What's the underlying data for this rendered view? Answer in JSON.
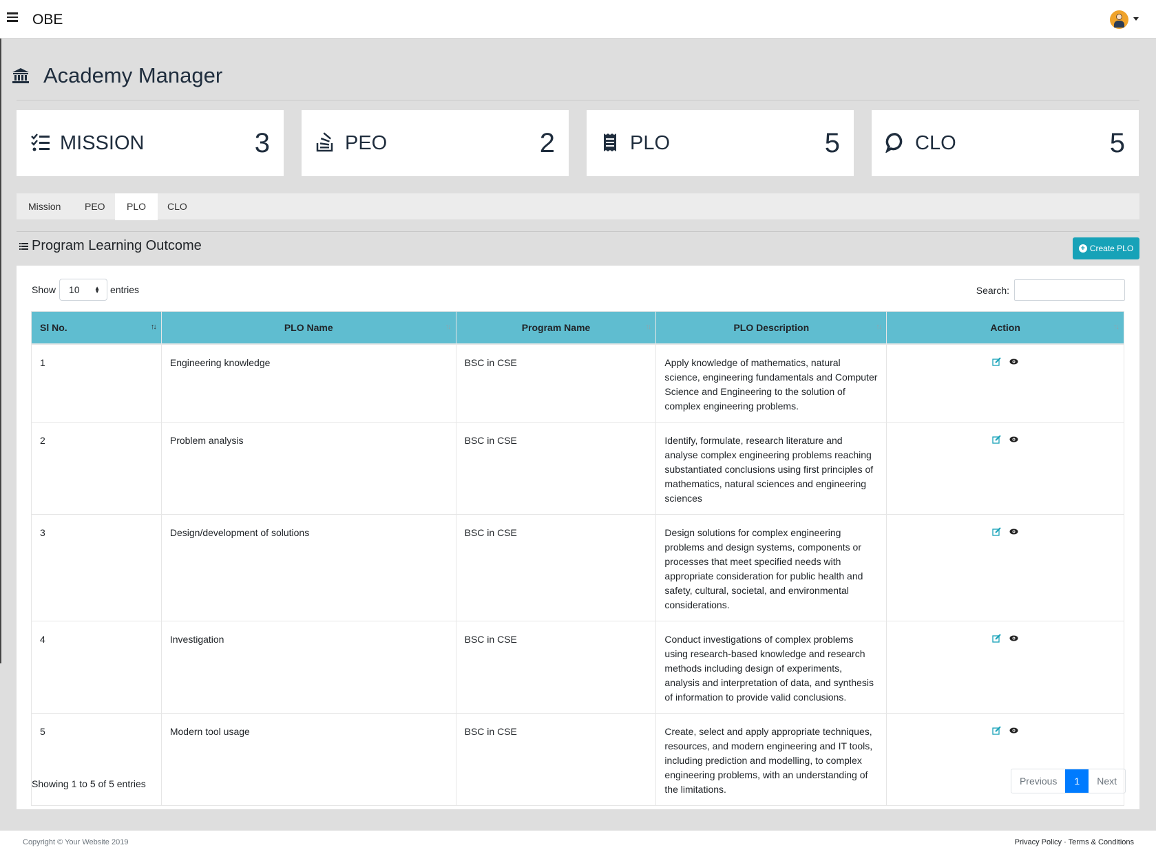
{
  "app": {
    "brand": "OBE"
  },
  "page": {
    "title": "Academy Manager"
  },
  "cards": [
    {
      "label": "MISSION",
      "count": "3",
      "icon": "list-check-icon"
    },
    {
      "label": "PEO",
      "count": "2",
      "icon": "stack-icon"
    },
    {
      "label": "PLO",
      "count": "5",
      "icon": "receipt-icon"
    },
    {
      "label": "CLO",
      "count": "5",
      "icon": "chat-bubble-icon"
    }
  ],
  "tabs": [
    "Mission",
    "PEO",
    "PLO",
    "CLO"
  ],
  "active_tab": "PLO",
  "section": {
    "title": "Program Learning Outcome",
    "create_button": "Create PLO"
  },
  "table_controls": {
    "show_label": "Show",
    "page_size": "10",
    "entries_label": "entries",
    "search_label": "Search:"
  },
  "table": {
    "headers": [
      "Sl No.",
      "PLO Name",
      "Program Name",
      "PLO Description",
      "Action"
    ],
    "rows": [
      {
        "sl": "1",
        "name": "Engineering knowledge",
        "program": "BSC in CSE",
        "description": "Apply knowledge of mathematics, natural science, engineering fundamentals and Computer Science and Engineering to the solution of complex engineering problems."
      },
      {
        "sl": "2",
        "name": "Problem analysis",
        "program": "BSC in CSE",
        "description": "Identify, formulate, research literature and analyse complex engineering problems reaching substantiated conclusions using first principles of mathematics, natural sciences and engineering sciences"
      },
      {
        "sl": "3",
        "name": "Design/development of solutions",
        "program": "BSC in CSE",
        "description": "Design solutions for complex engineering problems and design systems, components or processes that meet specified needs with appropriate consideration for public health and safety, cultural, societal, and environmental considerations."
      },
      {
        "sl": "4",
        "name": "Investigation",
        "program": "BSC in CSE",
        "description": "Conduct investigations of complex problems using research-based knowledge and research methods including design of experiments, analysis and interpretation of data, and synthesis of information to provide valid conclusions."
      },
      {
        "sl": "5",
        "name": "Modern tool usage",
        "program": "BSC in CSE",
        "description": "Create, select and apply appropriate techniques, resources, and modern engineering and IT tools, including prediction and modelling, to complex engineering problems, with an understanding of the limitations."
      }
    ]
  },
  "pagination": {
    "info": "Showing 1 to 5 of 5 entries",
    "previous": "Previous",
    "current": "1",
    "next": "Next"
  },
  "footer": {
    "copyright": "Copyright © Your Website 2019",
    "privacy": "Privacy Policy",
    "separator": "·",
    "terms": "Terms & Conditions"
  },
  "colors": {
    "header_bg": "#5fbdd0",
    "accent": "#17a2b8",
    "page_active": "#007bff",
    "background": "#dedede"
  }
}
